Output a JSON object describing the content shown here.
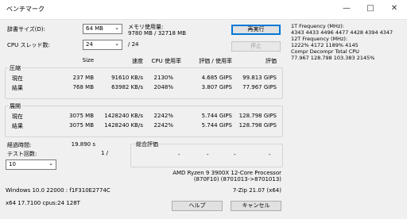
{
  "window": {
    "title": "ベンチマーク"
  },
  "controls": {
    "dict_label": "辞書サイズ(D):",
    "dict_value": "64 MB",
    "threads_label": "CPU スレッド数:",
    "threads_value": "24",
    "threads_total": "/ 24",
    "mem_label": "メモリ使用量:",
    "mem_value": "9780 MB / 32718 MB",
    "rerun_button": "再実行",
    "stop_button": "停止"
  },
  "side_info": {
    "lines": [
      "1T Frequency (MHz):",
      "4343 4433 4496 4477 4428 4394 4347",
      "12T Frequency (MHz):",
      "1222% 4172 1189% 4145",
      "Compr Decompr Total  CPU",
      "77.967  128.798  103.383   2145%"
    ]
  },
  "headers": {
    "size": "Size",
    "speed": "速度",
    "cpu_usage": "CPU 使用率",
    "rating_usage": "評価 / 使用率",
    "rating": "評価"
  },
  "compress": {
    "label": "圧縮",
    "rows": [
      {
        "name": "現在",
        "size": "237 MB",
        "speed": "91610 KB/s",
        "cpu": "2130%",
        "rate_usage": "4.685 GIPS",
        "rating": "99.813 GIPS"
      },
      {
        "name": "結果",
        "size": "768 MB",
        "speed": "63982 KB/s",
        "cpu": "2048%",
        "rate_usage": "3.807 GIPS",
        "rating": "77.967 GIPS"
      }
    ]
  },
  "decompress": {
    "label": "展開",
    "rows": [
      {
        "name": "現在",
        "size": "3075 MB",
        "speed": "1428240 KB/s",
        "cpu": "2242%",
        "rate_usage": "5.744 GIPS",
        "rating": "128.798 GIPS"
      },
      {
        "name": "結果",
        "size": "3075 MB",
        "speed": "1428240 KB/s",
        "cpu": "2242%",
        "rate_usage": "5.744 GIPS",
        "rating": "128.798 GIPS"
      }
    ]
  },
  "status": {
    "elapsed_label": "経過時間:",
    "elapsed_value": "19.890 s",
    "passes_label": "テスト回数:",
    "passes_value": "1 /",
    "passes_select": "10"
  },
  "overall": {
    "label": "総合評価",
    "values": [
      "-",
      "-",
      "-",
      "-"
    ]
  },
  "system": {
    "cpu": "AMD Ryzen 9 3900X 12-Core Processor",
    "cpu_id": "(870F10) (8701013->8701013)",
    "os": "Windows 10.0 22000 : f1F310E2774C",
    "version": "7-Zip 21.07 (x64)",
    "arch": "x64 17.7100 cpus:24 128T"
  },
  "footer": {
    "help_button": "ヘルプ",
    "cancel_button": "キャンセル"
  }
}
